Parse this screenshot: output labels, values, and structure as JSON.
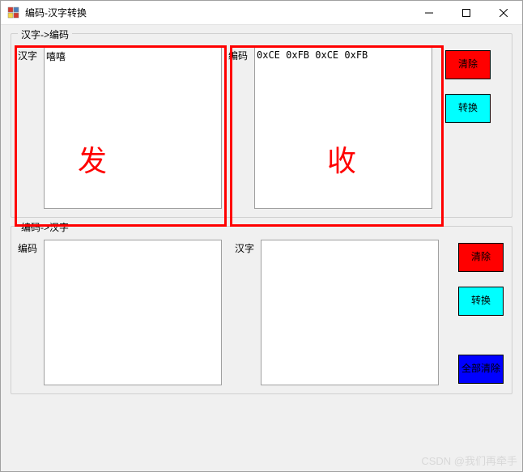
{
  "titlebar": {
    "title": "编码-汉字转换"
  },
  "group1": {
    "title": "汉字->编码",
    "hanzi_label": "汉字",
    "hanzi_value": "嘻嘻",
    "bianma_label": "编码",
    "bianma_value": "0xCE 0xFB 0xCE 0xFB",
    "clear_label": "清除",
    "convert_label": "转换",
    "annot_left": "发",
    "annot_right": "收"
  },
  "group2": {
    "title": "编码->汉字",
    "bianma_label": "编码",
    "bianma_value": "",
    "hanzi_label": "汉字",
    "hanzi_value": "",
    "clear_label": "清除",
    "convert_label": "转换",
    "clearall_label": "全部清除"
  },
  "watermark": "CSDN @我们再牵手"
}
